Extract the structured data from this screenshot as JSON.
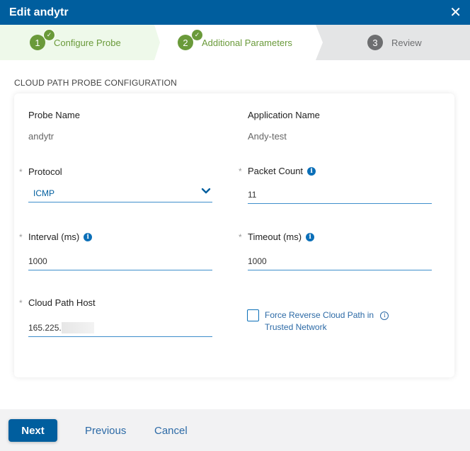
{
  "header": {
    "title": "Edit andytr",
    "close_icon": "close-icon"
  },
  "stepper": {
    "steps": [
      {
        "number": "1",
        "label": "Configure Probe",
        "status": "completed"
      },
      {
        "number": "2",
        "label": "Additional Parameters",
        "status": "completed"
      },
      {
        "number": "3",
        "label": "Review",
        "status": "pending"
      }
    ],
    "check_glyph": "✓"
  },
  "section_title": "CLOUD PATH PROBE CONFIGURATION",
  "form": {
    "required_marker": "*",
    "info_glyph": "i",
    "probe_name": {
      "label": "Probe Name",
      "value": "andytr"
    },
    "application_name": {
      "label": "Application Name",
      "value": "Andy-test"
    },
    "protocol": {
      "label": "Protocol",
      "value": "ICMP",
      "required": true
    },
    "packet_count": {
      "label": "Packet Count",
      "value": "11",
      "required": true
    },
    "interval": {
      "label": "Interval (ms)",
      "value": "1000",
      "required": true
    },
    "timeout": {
      "label": "Timeout (ms)",
      "value": "1000",
      "required": true
    },
    "cloud_path_host": {
      "label": "Cloud Path Host",
      "value": "165.225.",
      "required": true,
      "redacted_suffix": true
    },
    "force_reverse": {
      "label_line1": "Force Reverse Cloud Path in",
      "label_line2": "Trusted Network",
      "checked": false
    }
  },
  "footer": {
    "next_label": "Next",
    "previous_label": "Previous",
    "cancel_label": "Cancel"
  },
  "colors": {
    "header_bg": "#005e9e",
    "step_done": "#6a9a3a",
    "step_pending": "#6d6e70",
    "accent_link": "#2c6aa6",
    "input_underline": "#3e8ecb"
  }
}
